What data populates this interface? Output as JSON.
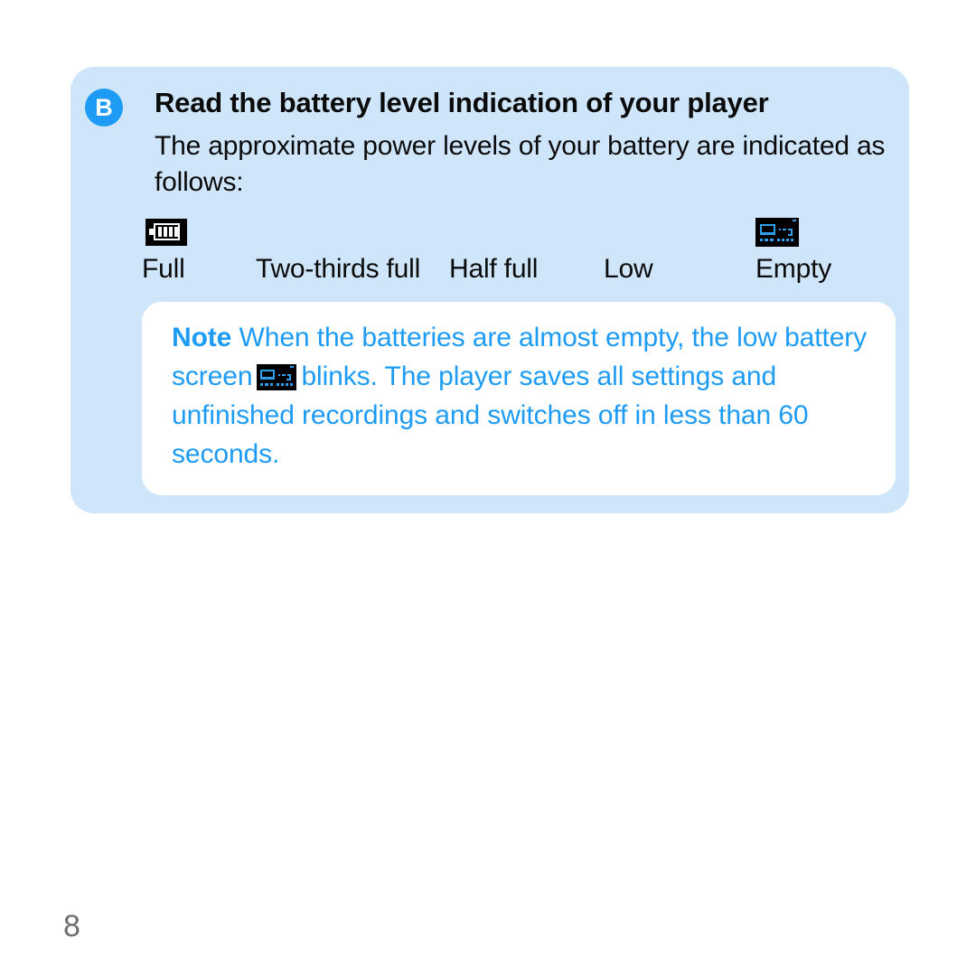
{
  "page": {
    "number": "8",
    "background_color": "#ffffff"
  },
  "panel": {
    "background_color": "#cfe6fa",
    "step": {
      "badge_letter": "B",
      "badge_color": "#1d9bf5",
      "title": "Read the battery level indication of your player",
      "body": "The approximate power levels of your battery are indicated as follows:"
    },
    "battery_levels": {
      "icons": [
        {
          "id": "full-battery-icon",
          "label": "Full"
        },
        {
          "id": "empty-battery-icon",
          "label": "Empty"
        }
      ],
      "labels": [
        "Full",
        "Two-thirds full",
        "Half full",
        "Low",
        "Empty"
      ]
    },
    "note": {
      "label": "Note",
      "text_part_1": "When the batteries are almost empty, the low battery screen",
      "text_part_2": "blinks. The player saves all settings and unfinished recordings and switches off in less than 60 seconds.",
      "icon_name": "low-battery-screen-icon",
      "text_color": "#1d9bf5",
      "background_color": "#ffffff"
    }
  }
}
